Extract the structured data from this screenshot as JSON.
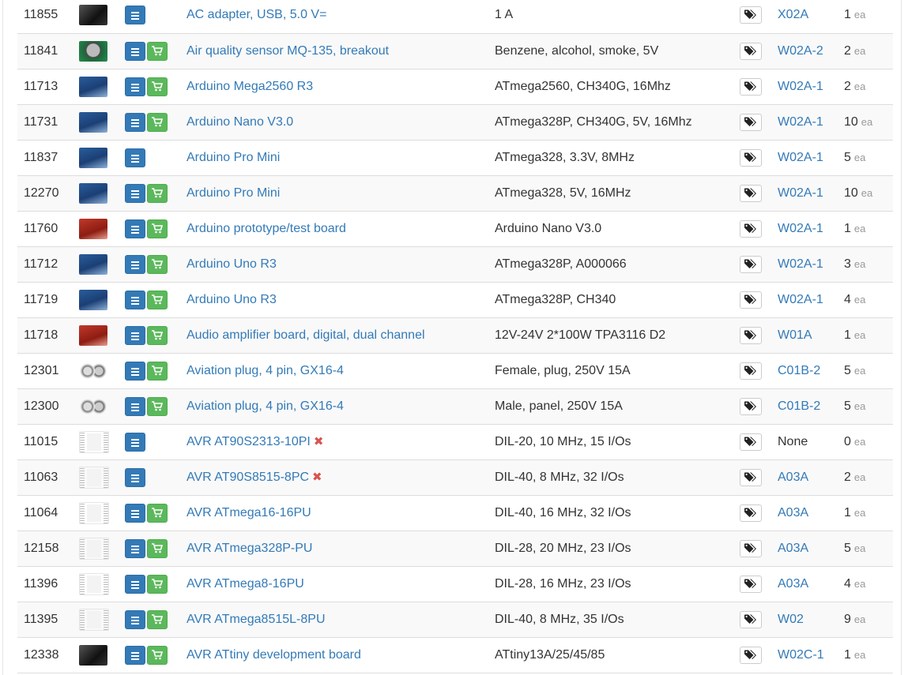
{
  "rows": [
    {
      "id": "11855",
      "image": "black",
      "has_cart": false,
      "name": "AC adapter, USB, 5.0 V=",
      "discontinued": false,
      "description": "1 A",
      "location": "X02A",
      "location_link": true,
      "qty": "1",
      "unit": "ea"
    },
    {
      "id": "11841",
      "image": "sensor",
      "has_cart": true,
      "name": "Air quality sensor MQ-135, breakout",
      "discontinued": false,
      "description": "Benzene, alcohol, smoke, 5V",
      "location": "W02A-2",
      "location_link": true,
      "qty": "2",
      "unit": "ea"
    },
    {
      "id": "11713",
      "image": "blue",
      "has_cart": true,
      "name": "Arduino Mega2560 R3",
      "discontinued": false,
      "description": "ATmega2560, CH340G, 16Mhz",
      "location": "W02A-1",
      "location_link": true,
      "qty": "2",
      "unit": "ea"
    },
    {
      "id": "11731",
      "image": "blue",
      "has_cart": true,
      "name": "Arduino Nano V3.0",
      "discontinued": false,
      "description": "ATmega328P, CH340G, 5V, 16Mhz",
      "location": "W02A-1",
      "location_link": true,
      "qty": "10",
      "unit": "ea"
    },
    {
      "id": "11837",
      "image": "blue",
      "has_cart": false,
      "name": "Arduino Pro Mini",
      "discontinued": false,
      "description": "ATmega328, 3.3V, 8MHz",
      "location": "W02A-1",
      "location_link": true,
      "qty": "5",
      "unit": "ea"
    },
    {
      "id": "12270",
      "image": "blue",
      "has_cart": true,
      "name": "Arduino Pro Mini",
      "discontinued": false,
      "description": "ATmega328, 5V, 16MHz",
      "location": "W02A-1",
      "location_link": true,
      "qty": "10",
      "unit": "ea"
    },
    {
      "id": "11760",
      "image": "red",
      "has_cart": true,
      "name": "Arduino prototype/test board",
      "discontinued": false,
      "description": "Arduino Nano V3.0",
      "location": "W02A-1",
      "location_link": true,
      "qty": "1",
      "unit": "ea"
    },
    {
      "id": "11712",
      "image": "blue",
      "has_cart": true,
      "name": "Arduino Uno R3",
      "discontinued": false,
      "description": "ATmega328P, A000066",
      "location": "W02A-1",
      "location_link": true,
      "qty": "3",
      "unit": "ea"
    },
    {
      "id": "11719",
      "image": "blue",
      "has_cart": true,
      "name": "Arduino Uno R3",
      "discontinued": false,
      "description": "ATmega328P, CH340",
      "location": "W02A-1",
      "location_link": true,
      "qty": "4",
      "unit": "ea"
    },
    {
      "id": "11718",
      "image": "red",
      "has_cart": true,
      "name": "Audio amplifier board, digital, dual channel",
      "discontinued": false,
      "description": "12V-24V 2*100W TPA3116 D2",
      "location": "W01A",
      "location_link": true,
      "qty": "1",
      "unit": "ea"
    },
    {
      "id": "12301",
      "image": "metal",
      "has_cart": true,
      "name": "Aviation plug, 4 pin, GX16-4",
      "discontinued": false,
      "description": "Female, plug, 250V 15A",
      "location": "C01B-2",
      "location_link": true,
      "qty": "5",
      "unit": "ea"
    },
    {
      "id": "12300",
      "image": "metal",
      "has_cart": true,
      "name": "Aviation plug, 4 pin, GX16-4",
      "discontinued": false,
      "description": "Male, panel, 250V 15A",
      "location": "C01B-2",
      "location_link": true,
      "qty": "5",
      "unit": "ea"
    },
    {
      "id": "11015",
      "image": "chip",
      "has_cart": false,
      "name": "AVR AT90S2313-10PI",
      "discontinued": true,
      "description": "DIL-20, 10 MHz, 15 I/Os",
      "location": "None",
      "location_link": false,
      "qty": "0",
      "unit": "ea"
    },
    {
      "id": "11063",
      "image": "chip",
      "has_cart": false,
      "name": "AVR AT90S8515-8PC",
      "discontinued": true,
      "description": "DIL-40, 8 MHz, 32 I/Os",
      "location": "A03A",
      "location_link": true,
      "qty": "2",
      "unit": "ea"
    },
    {
      "id": "11064",
      "image": "chip",
      "has_cart": true,
      "name": "AVR ATmega16-16PU",
      "discontinued": false,
      "description": "DIL-40, 16 MHz, 32 I/Os",
      "location": "A03A",
      "location_link": true,
      "qty": "1",
      "unit": "ea"
    },
    {
      "id": "12158",
      "image": "chip",
      "has_cart": true,
      "name": "AVR ATmega328P-PU",
      "discontinued": false,
      "description": "DIL-28, 20 MHz, 23 I/Os",
      "location": "A03A",
      "location_link": true,
      "qty": "5",
      "unit": "ea"
    },
    {
      "id": "11396",
      "image": "chip",
      "has_cart": true,
      "name": "AVR ATmega8-16PU",
      "discontinued": false,
      "description": "DIL-28, 16 MHz, 23 I/Os",
      "location": "A03A",
      "location_link": true,
      "qty": "4",
      "unit": "ea"
    },
    {
      "id": "11395",
      "image": "chip",
      "has_cart": true,
      "name": "AVR ATmega8515L-8PU",
      "discontinued": false,
      "description": "DIL-40, 8 MHz, 35 I/Os",
      "location": "W02",
      "location_link": true,
      "qty": "9",
      "unit": "ea"
    },
    {
      "id": "12338",
      "image": "black",
      "has_cart": true,
      "name": "AVR ATtiny development board",
      "discontinued": false,
      "description": "ATtiny13A/25/45/85",
      "location": "W02C-1",
      "location_link": true,
      "qty": "1",
      "unit": "ea"
    }
  ],
  "colors": {
    "link": "#337ab7",
    "list_button": "#337ab7",
    "cart_button": "#5cb85c",
    "discontinued_mark": "#d9534f"
  },
  "icons": {
    "details": "list-icon",
    "cart": "shopping-cart-icon",
    "tag": "tags-icon",
    "discontinued": "close-icon"
  }
}
